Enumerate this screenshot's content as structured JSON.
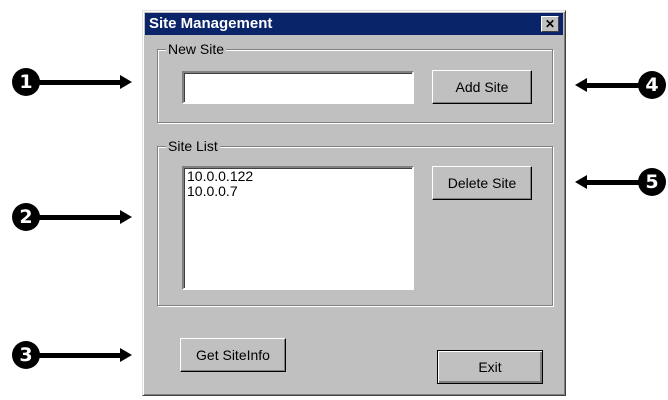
{
  "window": {
    "title": "Site Management",
    "close_glyph": "✕"
  },
  "new_site": {
    "group_label": "New Site",
    "input_value": "",
    "add_button": "Add Site"
  },
  "site_list": {
    "group_label": "Site List",
    "items": [
      "10.0.0.122",
      "10.0.0.7"
    ],
    "delete_button": "Delete Site"
  },
  "footer": {
    "get_siteinfo_button": "Get SiteInfo",
    "exit_button": "Exit"
  },
  "callouts": {
    "c1": "1",
    "c2": "2",
    "c3": "3",
    "c4": "4",
    "c5": "5"
  },
  "colors": {
    "titlebar": "#0a246a",
    "dialog": "#c0c0c0"
  }
}
